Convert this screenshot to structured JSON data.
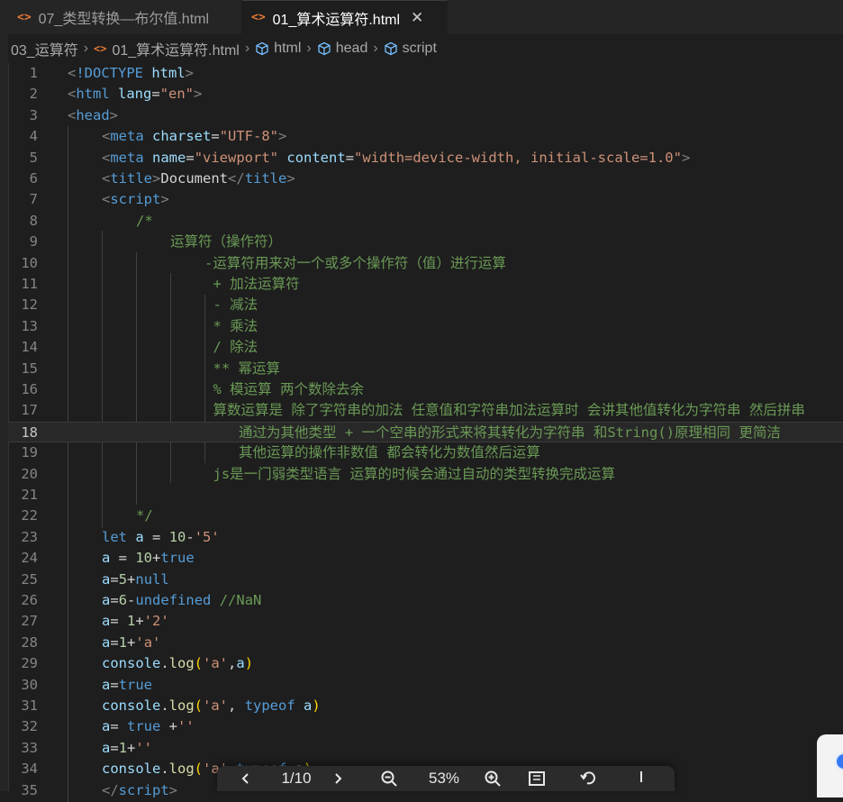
{
  "tabs": [
    {
      "icon": "<>",
      "label": "07_类型转换—布尔值.html"
    },
    {
      "icon": "<>",
      "label": "01_算术运算符.html",
      "close": "✕"
    }
  ],
  "breadcrumb": [
    "03_运算符",
    "01_算术运算符.html",
    "html",
    "head",
    "script"
  ],
  "current_line": 18,
  "lines": [
    {
      "n": "1",
      "ind": 0,
      "t": [
        [
          "t",
          "<"
        ],
        [
          "tg",
          "!DOCTYPE"
        ],
        [
          "pl",
          " "
        ],
        [
          "at",
          "html"
        ],
        [
          "t",
          ">"
        ]
      ]
    },
    {
      "n": "2",
      "ind": 0,
      "t": [
        [
          "t",
          "<"
        ],
        [
          "tg",
          "html"
        ],
        [
          "pl",
          " "
        ],
        [
          "at",
          "lang"
        ],
        [
          "pl",
          "="
        ],
        [
          "st",
          "\"en\""
        ],
        [
          "t",
          ">"
        ]
      ]
    },
    {
      "n": "3",
      "ind": 0,
      "t": [
        [
          "t",
          "<"
        ],
        [
          "tg",
          "head"
        ],
        [
          "t",
          ">"
        ]
      ]
    },
    {
      "n": "4",
      "ind": 4,
      "t": [
        [
          "t",
          "<"
        ],
        [
          "tg",
          "meta"
        ],
        [
          "pl",
          " "
        ],
        [
          "at",
          "charset"
        ],
        [
          "pl",
          "="
        ],
        [
          "st",
          "\"UTF-8\""
        ],
        [
          "t",
          ">"
        ]
      ]
    },
    {
      "n": "5",
      "ind": 4,
      "t": [
        [
          "t",
          "<"
        ],
        [
          "tg",
          "meta"
        ],
        [
          "pl",
          " "
        ],
        [
          "at",
          "name"
        ],
        [
          "pl",
          "="
        ],
        [
          "st",
          "\"viewport\""
        ],
        [
          "pl",
          " "
        ],
        [
          "at",
          "content"
        ],
        [
          "pl",
          "="
        ],
        [
          "st",
          "\"width=device-width, initial-scale=1.0\""
        ],
        [
          "t",
          ">"
        ]
      ]
    },
    {
      "n": "6",
      "ind": 4,
      "t": [
        [
          "t",
          "<"
        ],
        [
          "tg",
          "title"
        ],
        [
          "t",
          ">"
        ],
        [
          "pl",
          "Document"
        ],
        [
          "t",
          "</"
        ],
        [
          "tg",
          "title"
        ],
        [
          "t",
          ">"
        ]
      ]
    },
    {
      "n": "7",
      "ind": 4,
      "t": [
        [
          "t",
          "<"
        ],
        [
          "tg",
          "script"
        ],
        [
          "t",
          ">"
        ]
      ]
    },
    {
      "n": "8",
      "ind": 8,
      "t": [
        [
          "cm",
          "/*"
        ]
      ]
    },
    {
      "n": "9",
      "ind": 12,
      "t": [
        [
          "cm",
          "运算符（操作符）"
        ]
      ]
    },
    {
      "n": "10",
      "ind": 16,
      "t": [
        [
          "cm",
          "-运算符用来对一个或多个操作符（值）进行运算"
        ]
      ]
    },
    {
      "n": "11",
      "ind": 17,
      "t": [
        [
          "cm",
          "+ 加法运算符"
        ]
      ]
    },
    {
      "n": "12",
      "ind": 17,
      "t": [
        [
          "cm",
          "- 减法"
        ]
      ]
    },
    {
      "n": "13",
      "ind": 17,
      "t": [
        [
          "cm",
          "* 乘法"
        ]
      ]
    },
    {
      "n": "14",
      "ind": 17,
      "t": [
        [
          "cm",
          "/ 除法"
        ]
      ]
    },
    {
      "n": "15",
      "ind": 17,
      "t": [
        [
          "cm",
          "** 幂运算"
        ]
      ]
    },
    {
      "n": "16",
      "ind": 17,
      "t": [
        [
          "cm",
          "% 模运算 两个数除去余"
        ]
      ]
    },
    {
      "n": "17",
      "ind": 17,
      "t": [
        [
          "cm",
          "算数运算是 除了字符串的加法 任意值和字符串加法运算时 会讲其他值转化为字符串 然后拼串"
        ]
      ]
    },
    {
      "n": "18",
      "ind": 20,
      "t": [
        [
          "cm",
          "通过为其他类型 + 一个空串的形式来将其转化为字符串 和String()原理相同 更简洁"
        ]
      ]
    },
    {
      "n": "19",
      "ind": 20,
      "t": [
        [
          "cm",
          "其他运算的操作非数值 都会转化为数值然后运算"
        ]
      ]
    },
    {
      "n": "20",
      "ind": 17,
      "t": [
        [
          "cm",
          "js是一门弱类型语言 运算的时候会通过自动的类型转换完成运算"
        ]
      ]
    },
    {
      "n": "21",
      "ind": 0,
      "t": []
    },
    {
      "n": "22",
      "ind": 8,
      "t": [
        [
          "cm",
          "*/"
        ]
      ]
    },
    {
      "n": "23",
      "ind": 4,
      "t": [
        [
          "kw",
          "let"
        ],
        [
          "pl",
          " "
        ],
        [
          "vr",
          "a"
        ],
        [
          "pl",
          " = "
        ],
        [
          "nm",
          "10"
        ],
        [
          "pl",
          "-"
        ],
        [
          "st",
          "'5'"
        ]
      ]
    },
    {
      "n": "24",
      "ind": 4,
      "t": [
        [
          "vr",
          "a"
        ],
        [
          "pl",
          " = "
        ],
        [
          "nm",
          "10"
        ],
        [
          "pl",
          "+"
        ],
        [
          "kw",
          "true"
        ]
      ]
    },
    {
      "n": "25",
      "ind": 4,
      "t": [
        [
          "vr",
          "a"
        ],
        [
          "pl",
          "="
        ],
        [
          "nm",
          "5"
        ],
        [
          "pl",
          "+"
        ],
        [
          "kw",
          "null"
        ]
      ]
    },
    {
      "n": "26",
      "ind": 4,
      "t": [
        [
          "vr",
          "a"
        ],
        [
          "pl",
          "="
        ],
        [
          "nm",
          "6"
        ],
        [
          "pl",
          "-"
        ],
        [
          "kw",
          "undefined"
        ],
        [
          "pl",
          " "
        ],
        [
          "cm",
          "//NaN"
        ]
      ]
    },
    {
      "n": "27",
      "ind": 4,
      "t": [
        [
          "vr",
          "a"
        ],
        [
          "pl",
          "= "
        ],
        [
          "nm",
          "1"
        ],
        [
          "pl",
          "+"
        ],
        [
          "st",
          "'2'"
        ]
      ]
    },
    {
      "n": "28",
      "ind": 4,
      "t": [
        [
          "vr",
          "a"
        ],
        [
          "pl",
          "="
        ],
        [
          "nm",
          "1"
        ],
        [
          "pl",
          "+"
        ],
        [
          "st",
          "'a'"
        ]
      ]
    },
    {
      "n": "29",
      "ind": 4,
      "t": [
        [
          "vr",
          "console"
        ],
        [
          "pl",
          "."
        ],
        [
          "fn",
          "log"
        ],
        [
          "br",
          "("
        ],
        [
          "st",
          "'a'"
        ],
        [
          "pl",
          ","
        ],
        [
          "vr",
          "a"
        ],
        [
          "br",
          ")"
        ]
      ]
    },
    {
      "n": "30",
      "ind": 4,
      "t": [
        [
          "vr",
          "a"
        ],
        [
          "pl",
          "="
        ],
        [
          "kw",
          "true"
        ]
      ]
    },
    {
      "n": "31",
      "ind": 4,
      "t": [
        [
          "vr",
          "console"
        ],
        [
          "pl",
          "."
        ],
        [
          "fn",
          "log"
        ],
        [
          "br",
          "("
        ],
        [
          "st",
          "'a'"
        ],
        [
          "pl",
          ", "
        ],
        [
          "kw",
          "typeof"
        ],
        [
          "pl",
          " "
        ],
        [
          "vr",
          "a"
        ],
        [
          "br",
          ")"
        ]
      ]
    },
    {
      "n": "32",
      "ind": 4,
      "t": [
        [
          "vr",
          "a"
        ],
        [
          "pl",
          "= "
        ],
        [
          "kw",
          "true"
        ],
        [
          "pl",
          " +"
        ],
        [
          "st",
          "''"
        ]
      ]
    },
    {
      "n": "33",
      "ind": 4,
      "t": [
        [
          "vr",
          "a"
        ],
        [
          "pl",
          "="
        ],
        [
          "nm",
          "1"
        ],
        [
          "pl",
          "+"
        ],
        [
          "st",
          "''"
        ]
      ]
    },
    {
      "n": "34",
      "ind": 4,
      "t": [
        [
          "vr",
          "console"
        ],
        [
          "pl",
          "."
        ],
        [
          "fn",
          "log"
        ],
        [
          "br",
          "("
        ],
        [
          "st",
          "'a'"
        ],
        [
          "pl",
          ","
        ],
        [
          "kw",
          "typeof"
        ],
        [
          "pl",
          " "
        ],
        [
          "vr",
          "a"
        ],
        [
          "br",
          ")"
        ]
      ]
    },
    {
      "n": "35",
      "ind": 4,
      "t": [
        [
          "t",
          "</"
        ],
        [
          "tg",
          "script"
        ],
        [
          "t",
          ">"
        ]
      ]
    }
  ],
  "viewer": {
    "prev_icon": "chevron-left-icon",
    "page": "1/10",
    "next_icon": "chevron-right-icon",
    "zoom_out_icon": "zoom-out-icon",
    "zoom": "53%",
    "zoom_in_icon": "zoom-in-icon",
    "fit_icon": "fit-page-icon",
    "rotate_icon": "rotate-icon",
    "more_icon": "more-icon"
  },
  "colors": {
    "tag": "#569cd6",
    "attr": "#9cdcfe",
    "string": "#ce9178",
    "comment": "#6a9955",
    "number": "#b5cea8",
    "function": "#dcdcaa",
    "html_icon": "#e37933"
  }
}
